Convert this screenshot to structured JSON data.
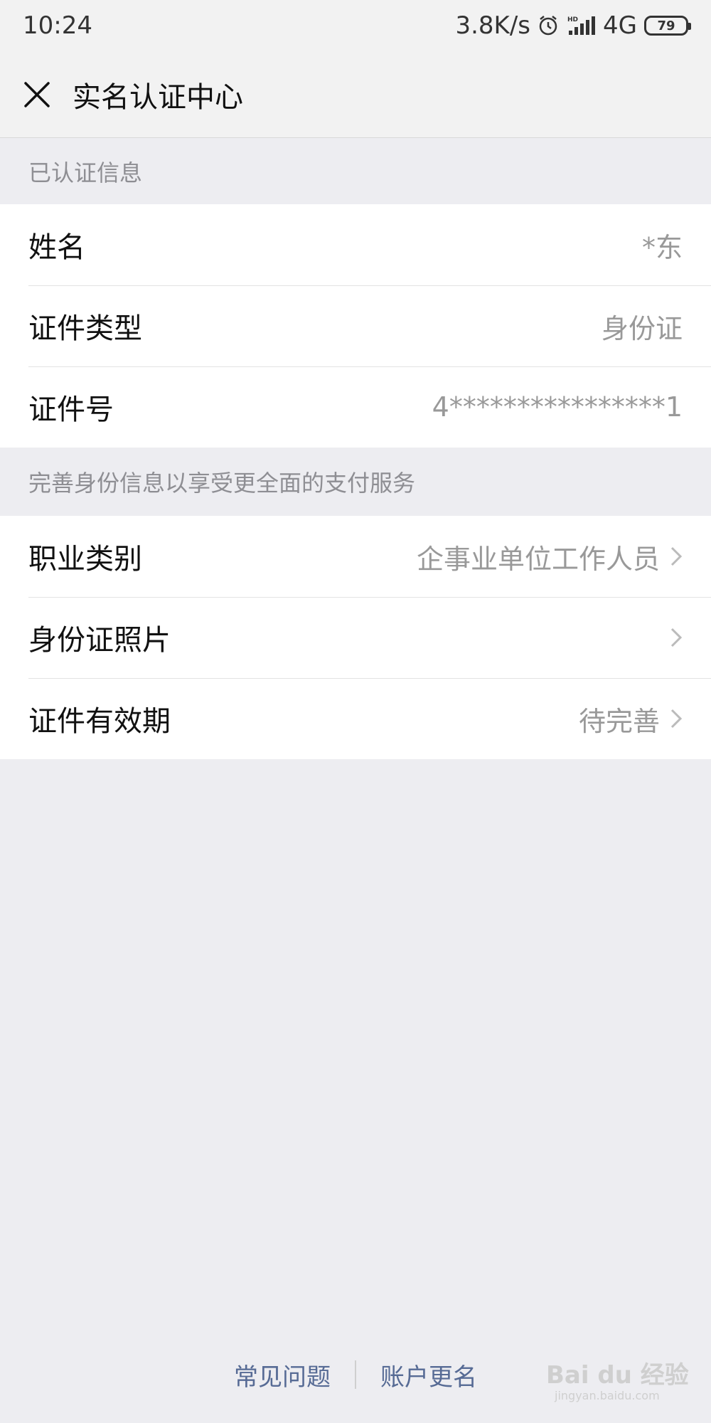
{
  "status_bar": {
    "time": "10:24",
    "network_speed": "3.8K/s",
    "network_type": "4G",
    "battery": "79",
    "icons": [
      "alarm-icon",
      "hd-signal-icon",
      "battery-icon"
    ]
  },
  "header": {
    "title": "实名认证中心",
    "close_icon": "close-icon"
  },
  "verified_section": {
    "title": "已认证信息",
    "rows": [
      {
        "label": "姓名",
        "value": "*东"
      },
      {
        "label": "证件类型",
        "value": "身份证"
      },
      {
        "label": "证件号",
        "value": "4****************1"
      }
    ]
  },
  "complete_section": {
    "title": "完善身份信息以享受更全面的支付服务",
    "rows": [
      {
        "label": "职业类别",
        "value": "企事业单位工作人员"
      },
      {
        "label": "身份证照片",
        "value": ""
      },
      {
        "label": "证件有效期",
        "value": "待完善"
      }
    ]
  },
  "footer": {
    "faq": "常见问题",
    "rename": "账户更名"
  },
  "watermark": {
    "text": "Bai du 经验",
    "sub": "jingyan.baidu.com"
  },
  "colors": {
    "background": "#ededf1",
    "header_bg": "#f2f2f2",
    "link": "#576b95",
    "secondary_text": "#999999"
  }
}
